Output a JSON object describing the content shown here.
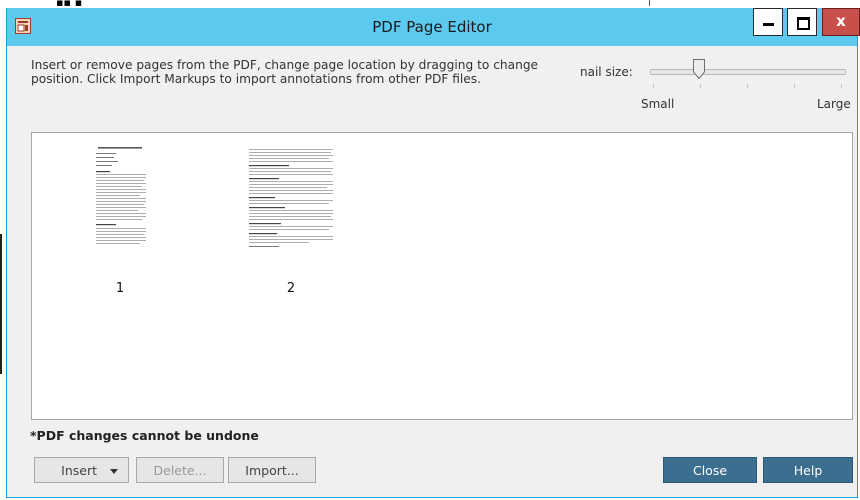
{
  "window": {
    "title": "PDF Page Editor",
    "controls": {
      "minimize_icon": "minimize-icon",
      "maximize_icon": "maximize-icon",
      "close_glyph": "x"
    },
    "app_icon": "pdf-editor-icon"
  },
  "instructions": "Insert or remove pages from the PDF, change page location by dragging to change position.  Click Import Markups to import annotations from other PDF files.",
  "thumbnail_size": {
    "label": "nail size:",
    "min_label": "Small",
    "max_label": "Large",
    "value": 0.28
  },
  "pages": [
    {
      "number": "1"
    },
    {
      "number": "2"
    }
  ],
  "warning": "*PDF changes cannot be undone",
  "buttons": {
    "insert": "Insert",
    "delete": "Delete...",
    "import": "Import...",
    "close": "Close",
    "help": "Help"
  },
  "colors": {
    "titlebar": "#5cc9ee",
    "close_button": "#c7504a",
    "primary_button": "#3c6e8f"
  }
}
